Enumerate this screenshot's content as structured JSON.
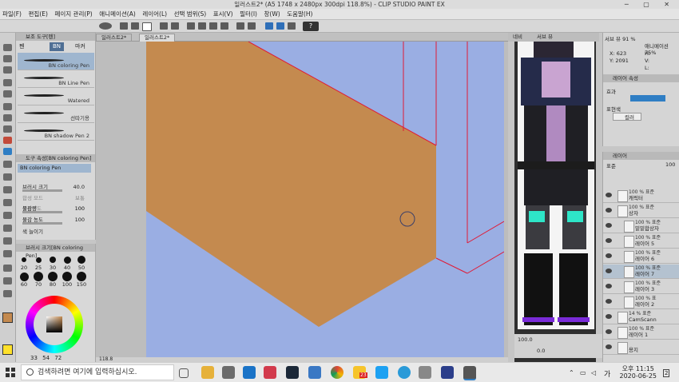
{
  "window": {
    "title": "일러스트2* (A5 1748 x 2480px 300dpi 118.8%)  -  CLIP STUDIO PAINT EX",
    "controls": "─ ▢ ✕"
  },
  "menu": [
    "파일(F)",
    "편집(E)",
    "페이지 관리(P)",
    "애니메이션(A)",
    "레이어(L)",
    "선택 범위(S)",
    "표시(V)",
    "필터(I)",
    "창(W)",
    "도움말(H)"
  ],
  "help_label": "?",
  "subtool": {
    "header": "보조 도구[펜]",
    "tabs": [
      "펜",
      "BN",
      "마커"
    ],
    "brushes": [
      "BN coloring Pen",
      "BN Line Pen",
      "Watered",
      "선따기용",
      "BN shadow Pen 2"
    ]
  },
  "tool_property": {
    "header": "도구 속성[BN coloring Pen]",
    "brush_name": "BN coloring Pen",
    "rows": [
      {
        "label": "브러시 크기",
        "value": "40.0"
      },
      {
        "label": "합성 모드",
        "value": "보통"
      },
      {
        "label": "불투명도",
        "value": "100"
      },
      {
        "label": "물감량",
        "value": "100"
      },
      {
        "label": "물감 농도",
        "value": "100"
      },
      {
        "label": "색 늘이기",
        "value": ""
      }
    ]
  },
  "brush_size": {
    "header": "브러시 크기[BN coloring Pen]",
    "sizes": [
      "20",
      "25",
      "30",
      "40",
      "50",
      "60",
      "70",
      "80",
      "100",
      "150"
    ]
  },
  "color": {
    "main": "#c48a4f",
    "values": [
      "54",
      "72"
    ],
    "extra": "33"
  },
  "canvas": {
    "tabs": [
      "일러스트2*",
      "일러스트2*"
    ],
    "zoom": "118.8",
    "background": "#9aaee3",
    "fill": "#c48a4f",
    "guide": "#e01a35"
  },
  "navigator": {
    "tabs": [
      "네비",
      "서브 뷰"
    ],
    "zoom": "100.0",
    "angle": "0.0"
  },
  "info": {
    "header": "서브 뷰  91 %",
    "header2": "애니메이션 75%",
    "x_label": "X: 623",
    "y_label": "Y: 2091",
    "h": "H:",
    "v": "V:",
    "l": "L:"
  },
  "layer_property": {
    "header": "레이어 속성",
    "effect": "효과",
    "expression": "표현색",
    "color_mode": "컬러"
  },
  "layers": {
    "header": "레이어",
    "blend": "표준",
    "opacity": "100",
    "rows": [
      {
        "op": "100 % 표준",
        "name": "캐릭터"
      },
      {
        "op": "100 % 표준",
        "name": "상자"
      },
      {
        "op": "100 % 표준",
        "name": "밑밑합상자"
      },
      {
        "op": "100 % 표준",
        "name": "레이어 5"
      },
      {
        "op": "100 % 표준",
        "name": "레이어 6"
      },
      {
        "op": "100 % 표준",
        "name": "레이어 7"
      },
      {
        "op": "100 % 표준",
        "name": "레이어 3"
      },
      {
        "op": "100 % 표",
        "name": "레이어 2"
      },
      {
        "op": "14 % 표준",
        "name": "CamScann"
      },
      {
        "op": "100 % 표준",
        "name": "레이어 1"
      },
      {
        "op": "",
        "name": "용지"
      }
    ]
  },
  "taskbar": {
    "search_placeholder": "검색하려면 여기에 입력하십시오.",
    "badge": "23",
    "time": "오후 11:15",
    "date": "2020-06-25",
    "ime": "가",
    "notify": "2"
  }
}
